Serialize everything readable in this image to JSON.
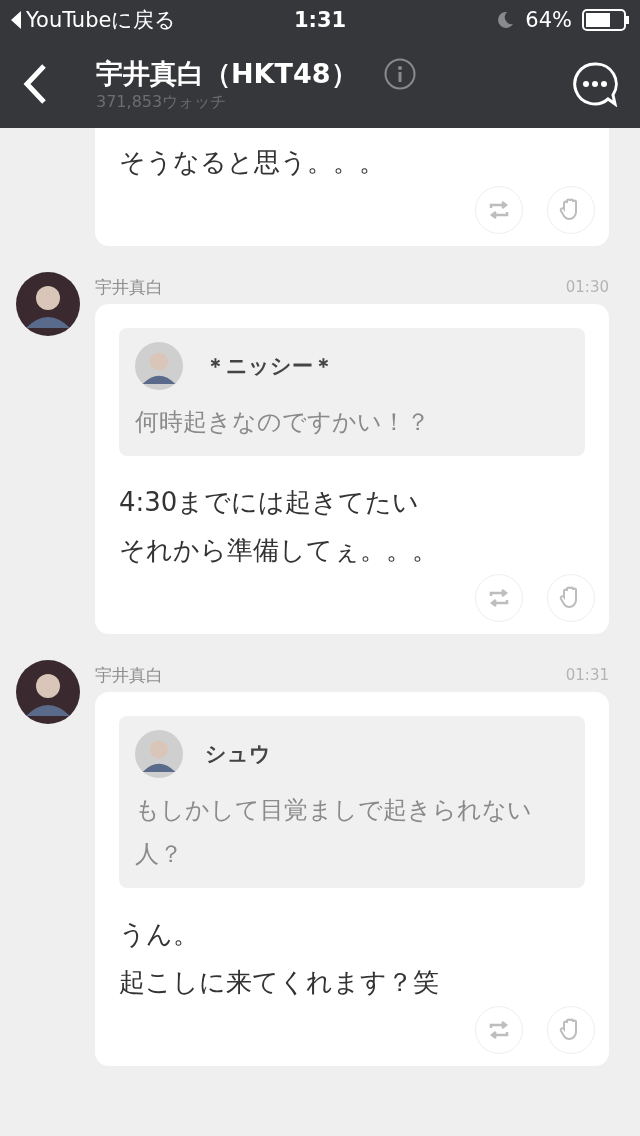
{
  "status_bar": {
    "back_label": "YouTubeに戻る",
    "time": "1:31",
    "battery_percent": "64%",
    "do_not_disturb": true
  },
  "header": {
    "title": "宇井真白（HKT48）",
    "subtitle": "371,853ウォッチ"
  },
  "messages": [
    {
      "cut_top": true,
      "lines": [
        "そうなると思う。。。"
      ]
    },
    {
      "cut_top": false,
      "sender": "宇井真白",
      "time": "01:30",
      "quote": {
        "name": "＊ニッシー＊",
        "text": "何時起きなのですかい！？"
      },
      "lines": [
        "4:30までには起きてたい",
        "それから準備してぇ。。。"
      ]
    },
    {
      "cut_top": false,
      "sender": "宇井真白",
      "time": "01:31",
      "quote": {
        "name": "シュウ",
        "text": "もしかして目覚ましで起きられない人？"
      },
      "lines": [
        "うん。",
        "起こしに来てくれます？笑"
      ]
    }
  ]
}
